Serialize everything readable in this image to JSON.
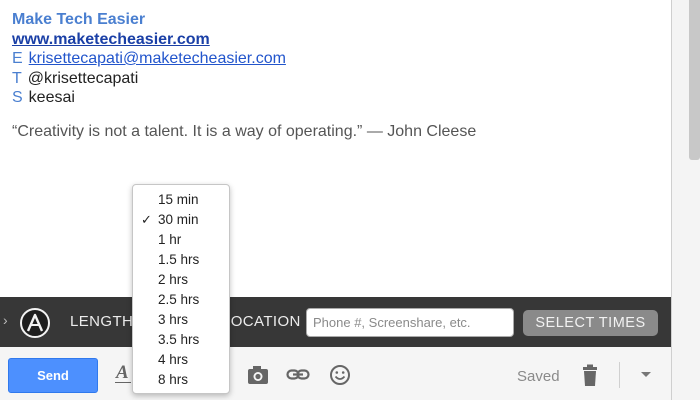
{
  "signature": {
    "name": "Make Tech Easier",
    "website": "www.maketecheasier.com",
    "rows": [
      {
        "letter": "E",
        "value": "krisettecapati@maketecheasier.com"
      },
      {
        "letter": "T",
        "value": "@krisettecapati"
      },
      {
        "letter": "S",
        "value": "keesai"
      }
    ]
  },
  "quote": "“Creativity is not a talent. It is a way of operating.” — John Cleese",
  "scheduler": {
    "length_label": "LENGTH",
    "location_label": "LOCATION",
    "phone_placeholder": "Phone #, Screenshare, etc.",
    "phone_value": "",
    "select_times_label": "SELECT TIMES",
    "logo_icon": "a-logo-icon"
  },
  "duration_menu": {
    "selected": "30 min",
    "check_mark": "✓",
    "options": [
      "15 min",
      "30 min",
      "1 hr",
      "1.5 hrs",
      "2 hrs",
      "2.5 hrs",
      "3 hrs",
      "3.5 hrs",
      "4 hrs",
      "8 hrs"
    ]
  },
  "bottom": {
    "send_label": "Send",
    "format_icon_glyph": "A",
    "saved_label": "Saved"
  },
  "colors": {
    "accent": "#4d90fe",
    "toolbar": "#373737",
    "link": "#2255cc"
  }
}
